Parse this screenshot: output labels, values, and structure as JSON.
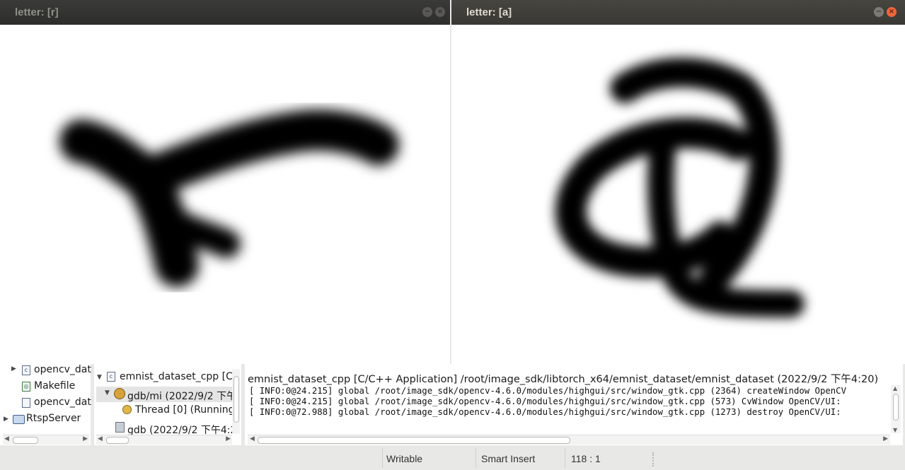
{
  "windows": {
    "left": {
      "title": "letter: [r]",
      "min_glyph": "−",
      "close_glyph": "×",
      "letter": "r"
    },
    "right": {
      "title": "letter: [a]",
      "min_glyph": "−",
      "close_glyph": "×",
      "letter": "a"
    }
  },
  "project_tree": {
    "items": [
      {
        "label": "opencv_dat",
        "icon": "c-file-icon"
      },
      {
        "label": "Makefile",
        "icon": "makefile-icon"
      },
      {
        "label": "opencv_dat",
        "icon": "file-icon"
      },
      {
        "label": "RtspServer",
        "icon": "project-folder-icon"
      }
    ]
  },
  "debug_tree": {
    "items": [
      {
        "label": "emnist_dataset_cpp [C/"
      },
      {
        "label": "gdb/mi (2022/9/2 下午"
      },
      {
        "label": "Thread [0] (Running"
      },
      {
        "label": "gdb (2022/9/2 下午4:2"
      }
    ]
  },
  "console": {
    "header": "emnist_dataset_cpp [C/C++ Application] /root/image_sdk/libtorch_x64/emnist_dataset/emnist_dataset (2022/9/2 下午4:20)",
    "lines": [
      "[ INFO:0@24.215] global /root/image_sdk/opencv-4.6.0/modules/highgui/src/window_gtk.cpp (2364) createWindow OpenCV",
      "[ INFO:0@24.215] global /root/image_sdk/opencv-4.6.0/modules/highgui/src/window_gtk.cpp (573) CvWindow OpenCV/UI:",
      "[ INFO:0@72.988] global /root/image_sdk/opencv-4.6.0/modules/highgui/src/window_gtk.cpp (1273) destroy OpenCV/UI:"
    ]
  },
  "statusbar": {
    "writable": "Writable",
    "insert_mode": "Smart Insert",
    "position": "118 : 1"
  }
}
